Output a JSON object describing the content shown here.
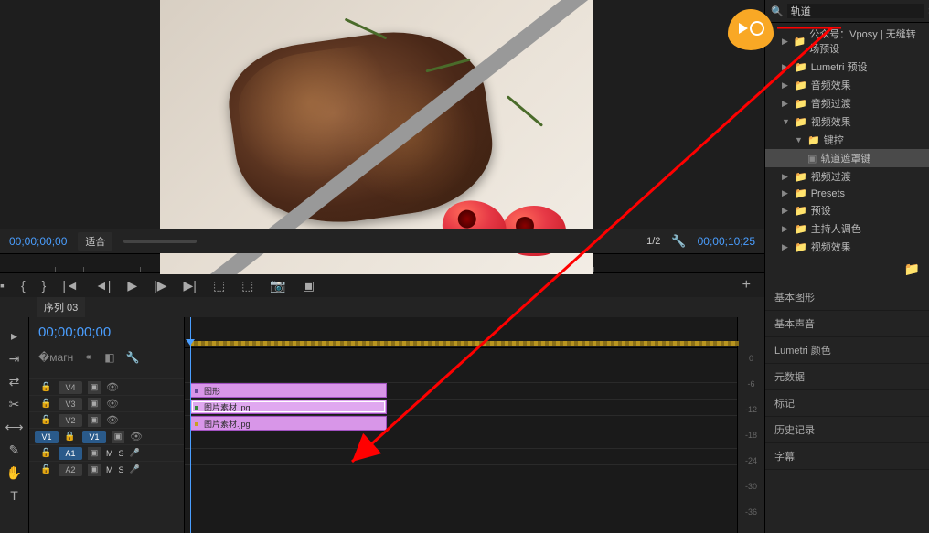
{
  "viewer": {
    "left_timecode": "00;00;00;00",
    "right_timecode": "00;00;10;25",
    "fit_label": "适合",
    "zoom_label": "1/2"
  },
  "sequence": {
    "tab_label": "序列 03",
    "timecode": "00;00;00;00"
  },
  "tracks": {
    "v4": "V4",
    "v3": "V3",
    "v2": "V2",
    "v1": "V1",
    "a1": "A1",
    "a2": "A2",
    "v1_src": "V1"
  },
  "clips": {
    "v3_label": "图形",
    "v2_label": "图片素材.jpg",
    "v1_label": "图片素材.jpg"
  },
  "scale": {
    "s0": "0",
    "s1": "-6",
    "s2": "-12",
    "s3": "-18",
    "s4": "-24",
    "s5": "-30",
    "s6": "-36"
  },
  "effects": {
    "search_value": "轨道",
    "items": {
      "preset_folder": "公众号：Vposy | 无缝转场预设",
      "lumetri": "Lumetri 预设",
      "audio_fx": "音频效果",
      "audio_trans": "音频过渡",
      "video_fx": "视频效果",
      "keying": "键控",
      "track_matte": "轨道遮罩键",
      "video_trans": "视频过渡",
      "presets": "Presets",
      "preset_cn": "预设",
      "announcer": "主持人调色",
      "video_fx2": "视频效果"
    }
  },
  "panels": {
    "essential_graphics": "基本图形",
    "essential_sound": "基本声音",
    "lumetri_color": "Lumetri 颜色",
    "metadata": "元数据",
    "markers": "标记",
    "history": "历史记录",
    "captions": "字幕"
  }
}
